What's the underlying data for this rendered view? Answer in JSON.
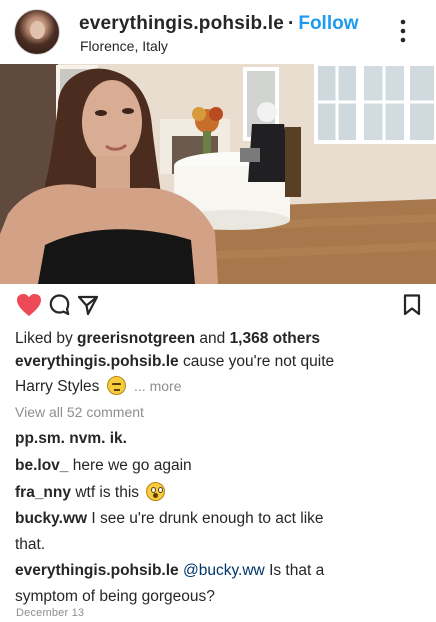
{
  "post": {
    "username": "everythingis.pohsib.le",
    "separator": "·",
    "follow_label": "Follow",
    "location": "Florence, Italy",
    "menu_icon": "more-vertical-icon"
  },
  "photo": {
    "icon": "photo-image"
  },
  "actions": {
    "like_icon": "heart-filled-icon",
    "like_color": "#ed4956",
    "comment_icon": "comment-icon",
    "share_icon": "send-icon",
    "save_icon": "bookmark-icon"
  },
  "likes": {
    "prefix": "Liked by",
    "liker": "greerisnotgreen",
    "joiner": "and",
    "count_text": "1,368 others"
  },
  "caption": {
    "username": "everythingis.pohsib.le",
    "text_line1": "cause you're not quite",
    "text_line2": "Harry Styles",
    "emoji": "unamused-face-emoji",
    "more_label": "... more"
  },
  "view_all_comments": "View all 52 comment",
  "comments": [
    {
      "user": "pp.sm.",
      "text": "nvm. ik."
    },
    {
      "user": "be.lov_",
      "text": "here we go again"
    },
    {
      "user": "fra_nny",
      "text": "wtf is this",
      "emoji": "astonished-face-emoji"
    },
    {
      "user": "bucky.ww",
      "text_line1": "I see u're drunk enough to act like",
      "text_line2": "that."
    },
    {
      "user": "everythingis.pohsib.le",
      "mention": "@bucky.ww",
      "text_line1": "Is that a",
      "text_line2": "symptom of being gorgeous?"
    }
  ],
  "timestamp": "December 13",
  "colors": {
    "follow": "#1e9bf0",
    "text": "#262626",
    "muted": "#8e8e8e",
    "mention": "#003569"
  }
}
